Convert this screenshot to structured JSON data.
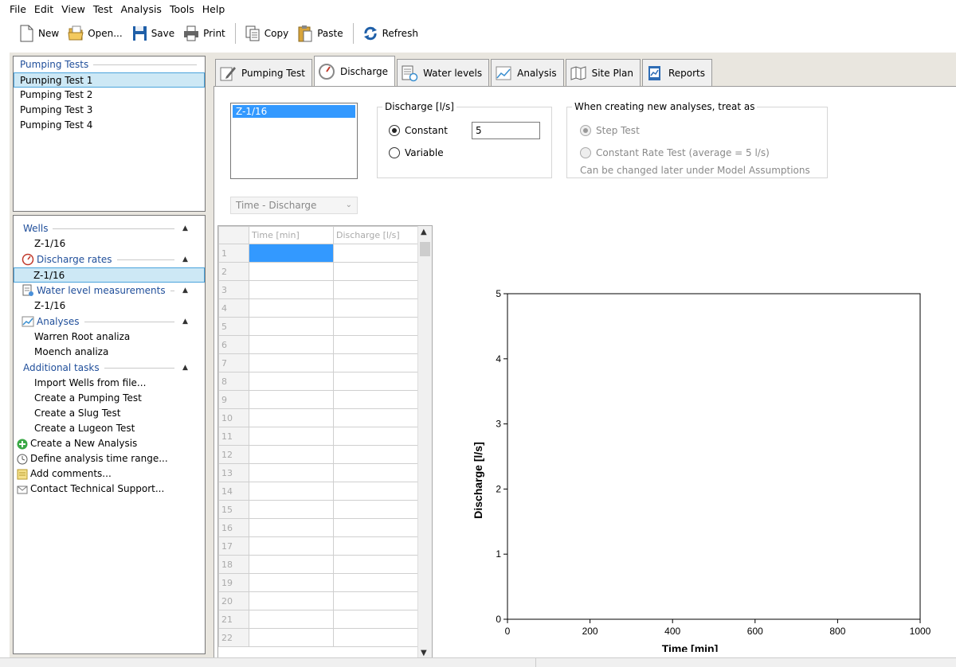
{
  "menu": [
    "File",
    "Edit",
    "View",
    "Test",
    "Analysis",
    "Tools",
    "Help"
  ],
  "toolbar": {
    "new": "New",
    "open": "Open...",
    "save": "Save",
    "print": "Print",
    "copy": "Copy",
    "paste": "Paste",
    "refresh": "Refresh"
  },
  "pumping_tests": {
    "header": "Pumping Tests",
    "items": [
      "Pumping Test 1",
      "Pumping Test 2",
      "Pumping Test 3",
      "Pumping Test 4"
    ]
  },
  "nav": {
    "wells": {
      "header": "Wells",
      "items": [
        "Z-1/16"
      ]
    },
    "discharge_rates": {
      "header": "Discharge rates",
      "items": [
        "Z-1/16"
      ]
    },
    "water_levels": {
      "header": "Water level measurements",
      "items": [
        "Z-1/16"
      ]
    },
    "analyses": {
      "header": "Analyses",
      "items": [
        "Warren Root analiza",
        "Moench analiza"
      ]
    },
    "additional": {
      "header": "Additional tasks",
      "items": [
        "Import Wells from file...",
        "Create a Pumping Test",
        "Create a Slug Test",
        "Create a Lugeon Test"
      ]
    },
    "tasks": [
      "Create a New Analysis",
      "Define analysis time range...",
      "Add comments...",
      "Contact Technical Support..."
    ]
  },
  "tabs": [
    "Pumping Test",
    "Discharge",
    "Water levels",
    "Analysis",
    "Site Plan",
    "Reports"
  ],
  "discharge": {
    "well_selected": "Z-1/16",
    "group_label": "Discharge [l/s]",
    "constant_label": "Constant",
    "variable_label": "Variable",
    "value": "5",
    "treat_label": "When creating new analyses, treat as",
    "step_test": "Step Test",
    "constant_rate": "Constant Rate Test (average = 5 l/s)",
    "hint": "Can be changed later under Model Assumptions",
    "select_value": "Time - Discharge"
  },
  "grid": {
    "headers": [
      "Time [min]",
      "Discharge [l/s]"
    ],
    "rows": [
      "1",
      "2",
      "3",
      "4",
      "5",
      "6",
      "7",
      "8",
      "9",
      "10",
      "11",
      "12",
      "13",
      "14",
      "15",
      "16",
      "17",
      "18",
      "19",
      "20",
      "21",
      "22"
    ]
  },
  "chart_data": {
    "type": "line",
    "xlabel": "Time [min]",
    "ylabel": "Discharge [l/s]",
    "xlim": [
      0,
      1000
    ],
    "ylim": [
      0,
      5
    ],
    "xticks": [
      0,
      200,
      400,
      600,
      800,
      1000
    ],
    "yticks": [
      0,
      1,
      2,
      3,
      4,
      5
    ],
    "series": [],
    "grid": false
  }
}
